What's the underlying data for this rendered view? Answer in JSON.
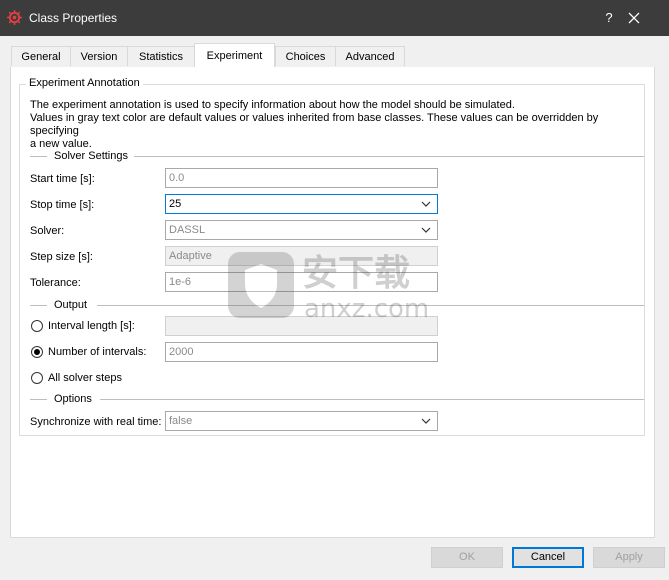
{
  "window": {
    "title": "Class Properties",
    "help_label": "?"
  },
  "tabs": [
    {
      "label": "General"
    },
    {
      "label": "Version"
    },
    {
      "label": "Statistics"
    },
    {
      "label": "Experiment"
    },
    {
      "label": "Choices"
    },
    {
      "label": "Advanced"
    }
  ],
  "active_tab": "Experiment",
  "experiment": {
    "group_title": "Experiment Annotation",
    "description_line1": "The experiment annotation is used to specify information about how the model should be simulated.",
    "description_line2": "Values in gray text color are default values or values inherited from base classes. These values can be overridden by specifying",
    "description_line3": "a new value.",
    "solver_settings": {
      "heading": "Solver Settings",
      "start_time": {
        "label": "Start time [s]:",
        "value": "0.0"
      },
      "stop_time": {
        "label": "Stop time [s]:",
        "value": "25"
      },
      "solver": {
        "label": "Solver:",
        "value": "DASSL"
      },
      "step_size": {
        "label": "Step size [s]:",
        "value": "Adaptive"
      },
      "tolerance": {
        "label": "Tolerance:",
        "value": "1e-6"
      }
    },
    "output": {
      "heading": "Output",
      "interval_length": {
        "label": "Interval length [s]:",
        "value": "",
        "selected": false
      },
      "number_of_intervals": {
        "label": "Number of intervals:",
        "value": "2000",
        "selected": true
      },
      "all_solver_steps": {
        "label": "All solver steps",
        "selected": false
      }
    },
    "options": {
      "heading": "Options",
      "sync_real_time": {
        "label": "Synchronize with real time:",
        "value": "false"
      }
    }
  },
  "buttons": {
    "ok": "OK",
    "cancel": "Cancel",
    "apply": "Apply"
  },
  "watermark": {
    "text_cn": "安下载",
    "text_en": "anxz.com"
  }
}
